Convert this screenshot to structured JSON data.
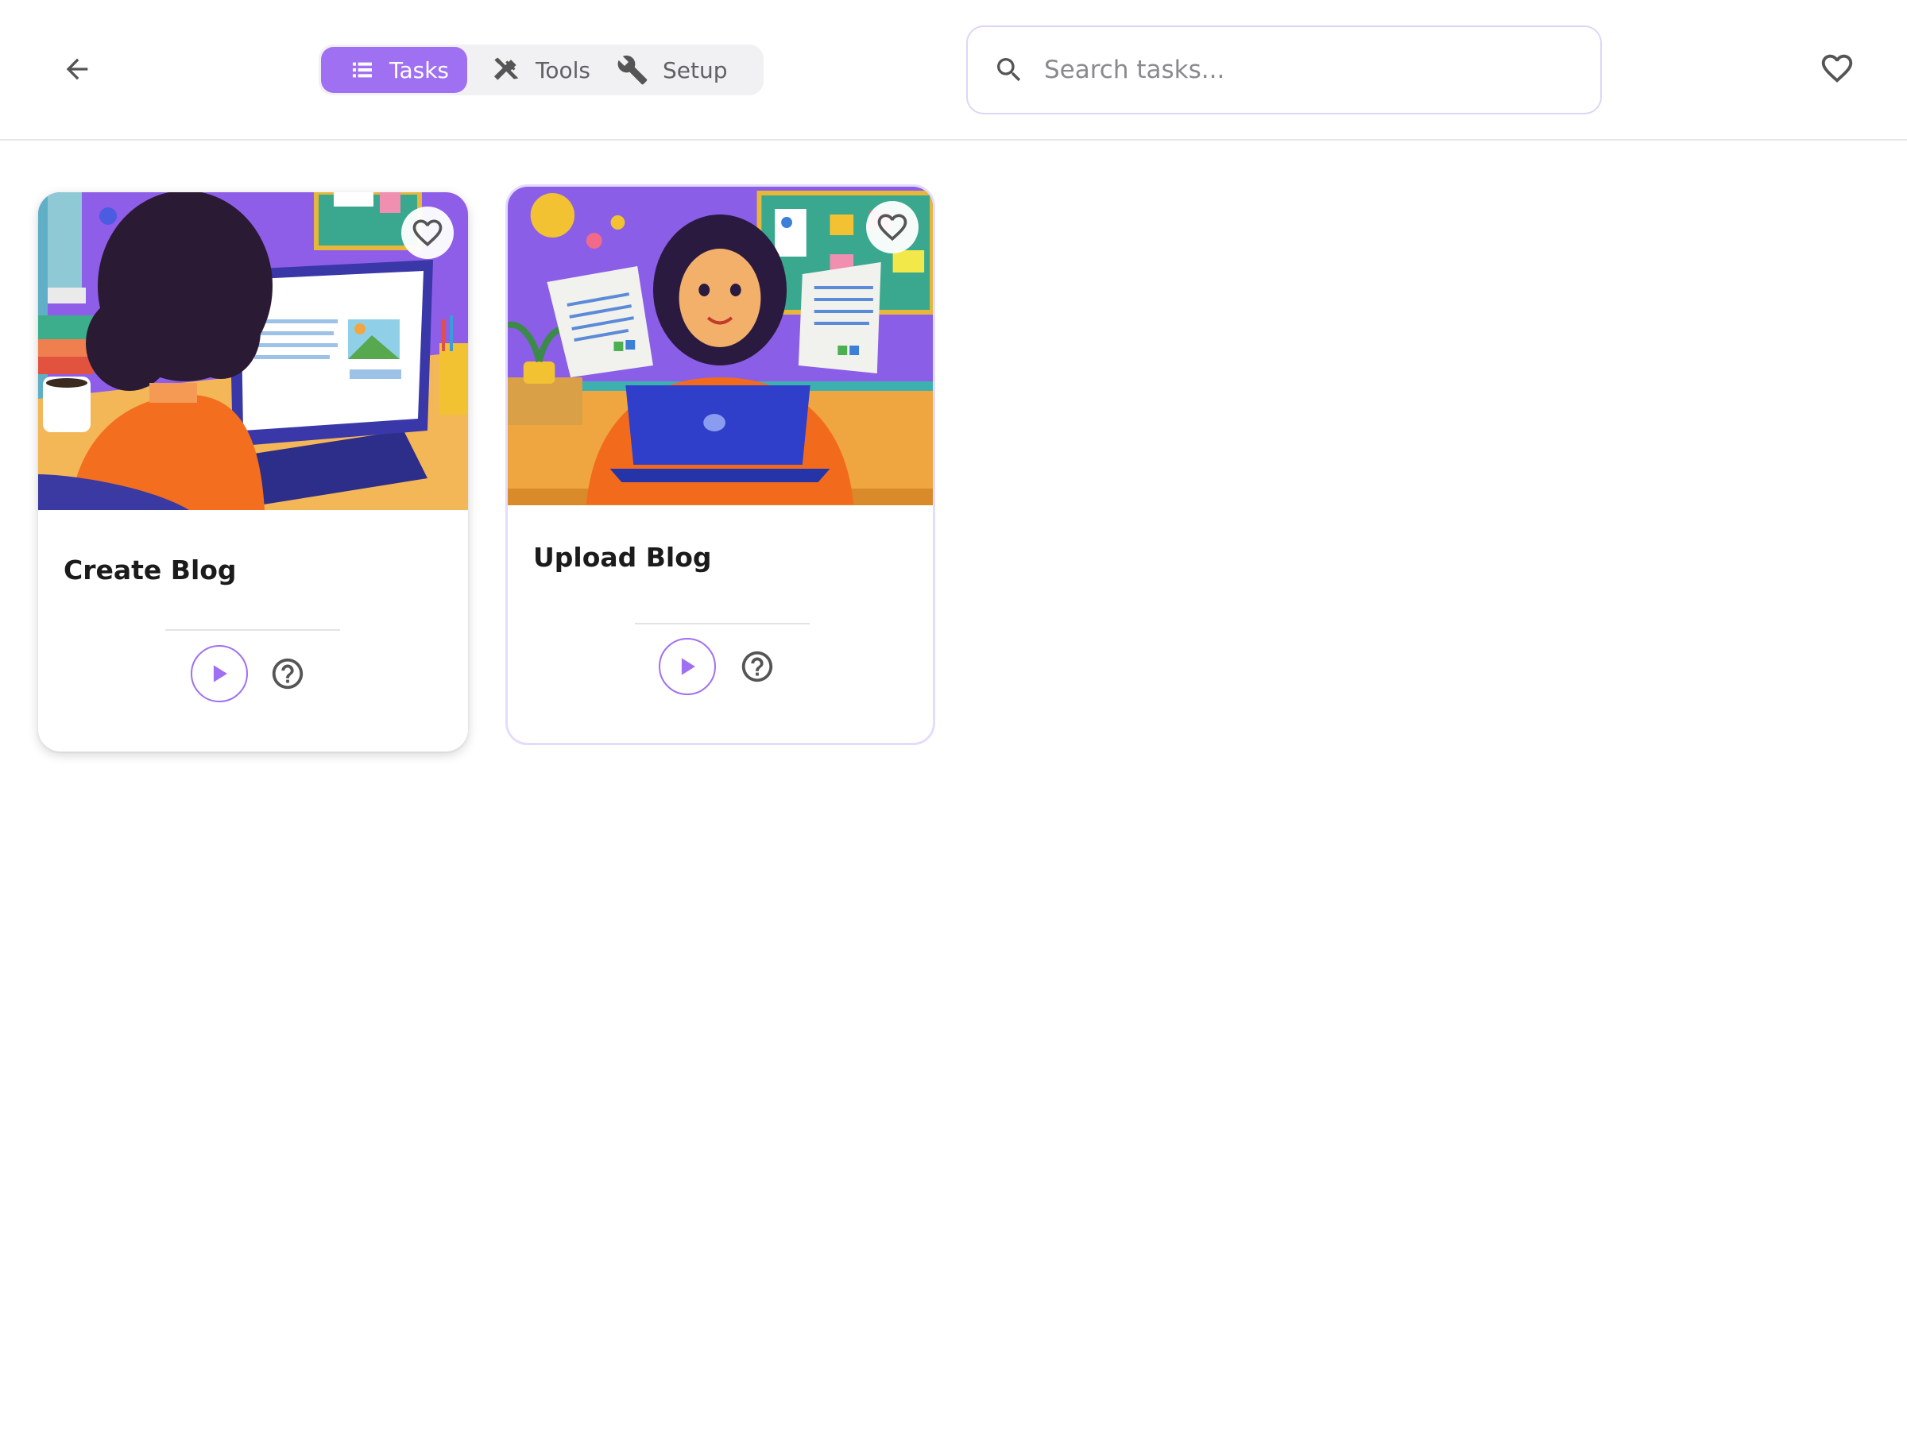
{
  "header": {
    "back_icon": "arrow-left-icon",
    "tabs": [
      {
        "label": "Tasks",
        "icon": "list-icon",
        "active": true
      },
      {
        "label": "Tools",
        "icon": "tools-icon",
        "active": false
      },
      {
        "label": "Setup",
        "icon": "wrench-icon",
        "active": false
      }
    ],
    "search": {
      "placeholder": "Search tasks...",
      "value": "",
      "icon": "search-icon"
    },
    "favorites_icon": "heart-outline-icon"
  },
  "cards": [
    {
      "title": "Create Blog",
      "image": "illustration-woman-typing-blog-on-laptop",
      "favorited": false
    },
    {
      "title": "Upload Blog",
      "image": "illustration-woman-holding-documents-with-laptop",
      "favorited": false
    }
  ],
  "colors": {
    "accent": "#a070f2",
    "accent_border": "#ddd6f6",
    "tab_bg": "#f1f1f3",
    "divider": "#e6e6ea"
  }
}
